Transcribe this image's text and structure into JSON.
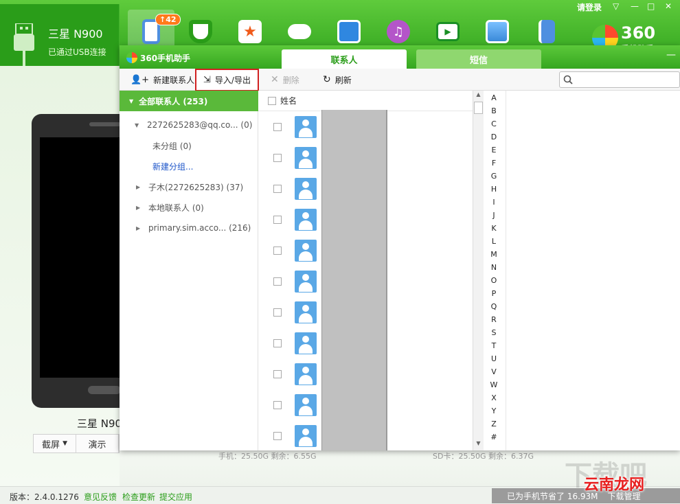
{
  "device": {
    "name": "三星 N900",
    "status": "已通过USB连接",
    "label": "三星 N90"
  },
  "nav": {
    "badge": "↑42"
  },
  "window_controls": {
    "login": "请登录"
  },
  "brand": {
    "logo_text": "360",
    "logo_sub": "手机助手"
  },
  "popup": {
    "title": "360手机助手",
    "tabs": [
      {
        "label": "联系人",
        "active": true
      },
      {
        "label": "短信",
        "active": false
      }
    ],
    "toolbar": {
      "new_contact": "新建联系人",
      "import_export": "导入/导出",
      "delete": "删除",
      "refresh": "刷新"
    },
    "groups": {
      "all": "全部联系人 (253)",
      "items": [
        {
          "label": "2272625283@qq.co... (0)",
          "expanded": true
        },
        {
          "label": "未分组 (0)"
        },
        {
          "label": "新建分组..."
        },
        {
          "label": "子木(2272625283) (37)"
        },
        {
          "label": "本地联系人 (0)"
        },
        {
          "label": "primary.sim.acco... (216)"
        }
      ]
    },
    "list": {
      "header": "姓名",
      "row_count": 11
    },
    "alphabet": [
      "A",
      "B",
      "C",
      "D",
      "E",
      "F",
      "G",
      "H",
      "I",
      "J",
      "K",
      "L",
      "M",
      "N",
      "O",
      "P",
      "Q",
      "R",
      "S",
      "T",
      "U",
      "V",
      "W",
      "X",
      "Y",
      "Z",
      "#"
    ]
  },
  "phone_actions": {
    "screenshot": "截屏",
    "demo": "演示"
  },
  "storage": {
    "phone": "手机：25.50G  剩余：6.55G",
    "sd": "SD卡：25.50G  剩余：6.37G"
  },
  "statusbar": {
    "version": "版本：2.4.0.1276",
    "feedback": "意见反馈",
    "check_update": "检查更新",
    "submit_app": "提交应用",
    "saved": "已为手机节省了 16.93M",
    "manage": "下载管理"
  },
  "watermark": {
    "text": "下载吧",
    "brand": "云南龙网"
  },
  "colors": {
    "accent": "#2fa21c",
    "highlight_border": "#d02020",
    "avatar": "#5aa8e6"
  }
}
